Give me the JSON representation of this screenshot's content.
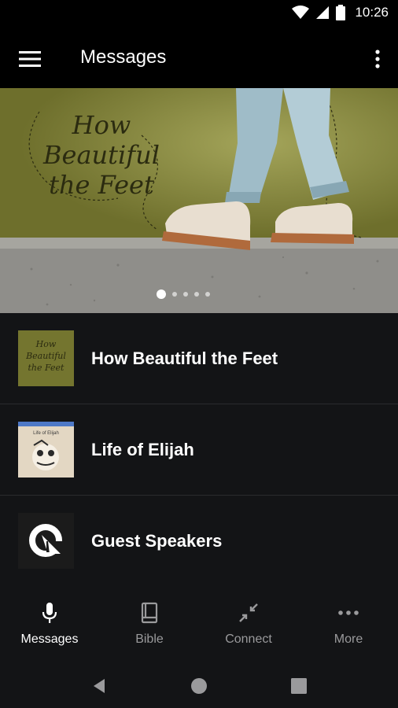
{
  "status_bar": {
    "time": "10:26"
  },
  "app_bar": {
    "title": "Messages"
  },
  "banner": {
    "title_line1": "How",
    "title_line2": "Beautiful",
    "title_line3": "the Feet",
    "slide_count": 5,
    "active_slide": 1
  },
  "series": [
    {
      "label": "How Beautiful the Feet",
      "thumb_line1": "How",
      "thumb_line2": "Beautiful",
      "thumb_line3": "the Feet"
    },
    {
      "label": "Life of Elijah",
      "thumb_text": "Life of Elijah"
    },
    {
      "label": "Guest Speakers"
    }
  ],
  "bottom_nav": {
    "items": [
      {
        "label": "Messages",
        "icon": "microphone-icon",
        "active": true
      },
      {
        "label": "Bible",
        "icon": "book-icon",
        "active": false
      },
      {
        "label": "Connect",
        "icon": "connect-icon",
        "active": false
      },
      {
        "label": "More",
        "icon": "more-horizontal-icon",
        "active": false
      }
    ]
  },
  "colors": {
    "background": "#131416",
    "bar": "#000000",
    "active_text": "#ffffff",
    "inactive_text": "#9a9a9c",
    "banner_green": "#7d7e35"
  }
}
